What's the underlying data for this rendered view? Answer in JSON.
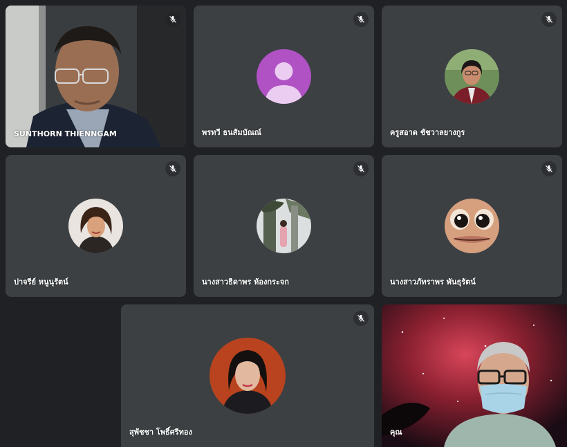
{
  "participants": [
    {
      "name": "SUNTHORN THIENNGAM",
      "muted": true,
      "type": "video"
    },
    {
      "name": "พรทวี ธนสัมบัณณ์",
      "muted": true,
      "type": "avatar-default"
    },
    {
      "name": "ครูสอาด ชัชวาลยางกูร",
      "muted": true,
      "type": "avatar-photo"
    },
    {
      "name": "ปาจรีย์ หนูนุรัตน์",
      "muted": true,
      "type": "avatar-photo"
    },
    {
      "name": "นางสาวธิดาพร ห้องกระจก",
      "muted": true,
      "type": "avatar-photo"
    },
    {
      "name": "นางสาวภัทราพร พันธุรัตน์",
      "muted": true,
      "type": "avatar-photo"
    },
    {
      "name": "สุพัชชา โพธิ์ศรีทอง",
      "muted": true,
      "type": "avatar-photo"
    },
    {
      "name": "คุณ",
      "muted": false,
      "type": "video"
    }
  ],
  "colors": {
    "background": "#202124",
    "tile": "#3c4043",
    "default_avatar": "#b052c4"
  }
}
